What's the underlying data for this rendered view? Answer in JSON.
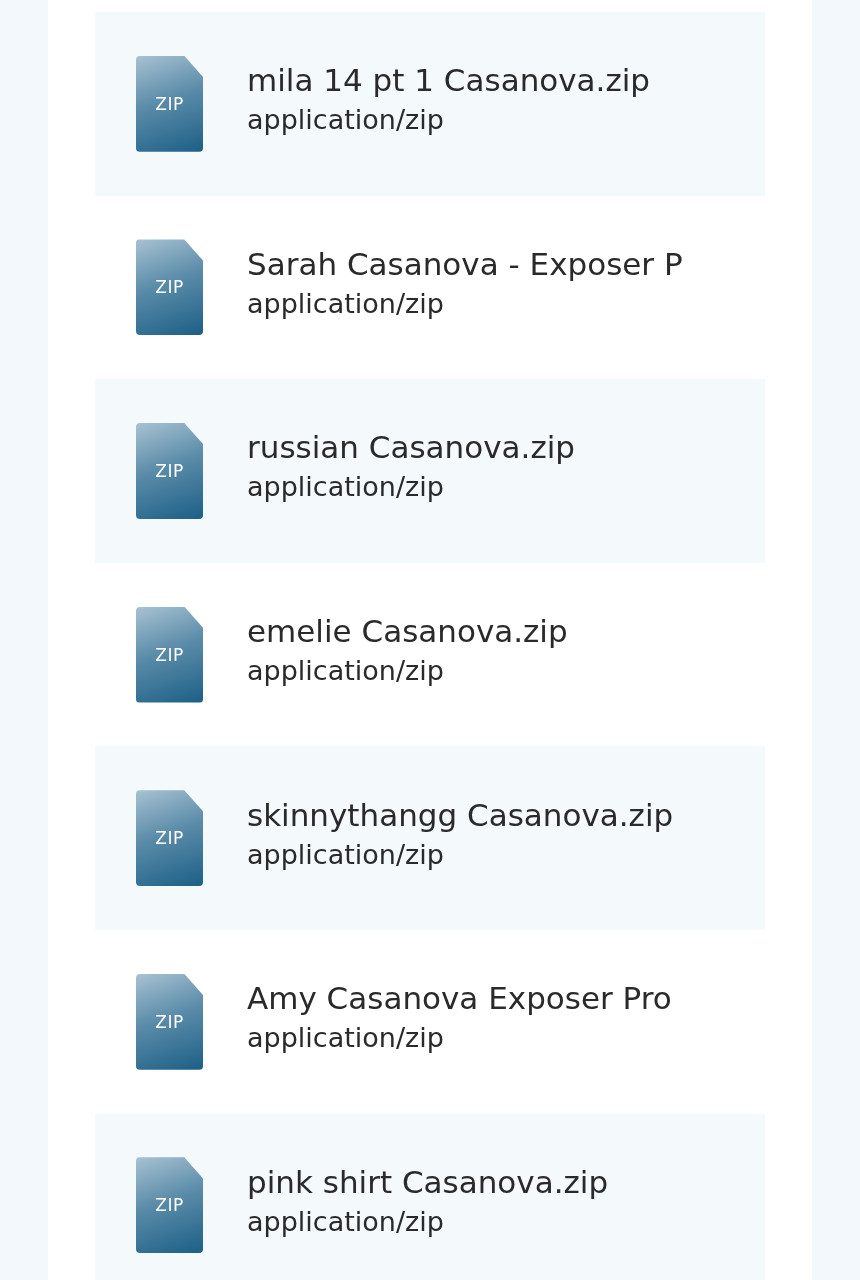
{
  "files": [
    {
      "name": "mila 14 pt 1 Casanova.zip",
      "type": "application/zip",
      "icon_label": "ZIP"
    },
    {
      "name": "Sarah Casanova - Exposer P",
      "type": "application/zip",
      "icon_label": "ZIP"
    },
    {
      "name": "russian Casanova.zip",
      "type": "application/zip",
      "icon_label": "ZIP"
    },
    {
      "name": "emelie Casanova.zip",
      "type": "application/zip",
      "icon_label": "ZIP"
    },
    {
      "name": "skinnythangg Casanova.zip",
      "type": "application/zip",
      "icon_label": "ZIP"
    },
    {
      "name": "Amy Casanova Exposer Pro",
      "type": "application/zip",
      "icon_label": "ZIP"
    },
    {
      "name": "pink shirt Casanova.zip",
      "type": "application/zip",
      "icon_label": "ZIP"
    }
  ]
}
